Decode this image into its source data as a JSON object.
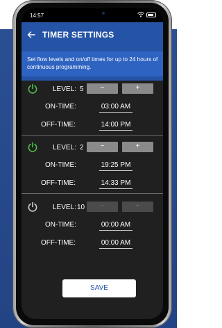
{
  "status": {
    "time": "14:57"
  },
  "header": {
    "title": "TIMER SETTINGS",
    "subtitle": "Set flow levels and on/off times for up to 24 hours of continuous programming."
  },
  "groups": [
    {
      "level_label": "LEVEL:",
      "level": "5",
      "on_label": "ON-TIME:",
      "on_time": "03:00 AM",
      "off_label": "OFF-TIME:",
      "off_time": "14:00 PM",
      "active": true
    },
    {
      "level_label": "LEVEL:",
      "level": "2",
      "on_label": "ON-TIME:",
      "on_time": "19:25 PM",
      "off_label": "OFF-TIME:",
      "off_time": "14:33 PM",
      "active": true
    },
    {
      "level_label": "LEVEL:",
      "level": "10",
      "on_label": "ON-TIME:",
      "on_time": "00:00 AM",
      "off_label": "OFF-TIME:",
      "off_time": "00:00 AM",
      "active": false
    }
  ],
  "buttons": {
    "minus": "−",
    "plus": "+",
    "save": "SAVE"
  },
  "colors": {
    "header": "#2553a6",
    "subtitle_band": "#2f63c2",
    "screen_bg": "#202020",
    "power_active": "#4cc04a",
    "power_inactive": "#cfcfcf"
  },
  "icons": {
    "back": "back-arrow-icon",
    "power": "power-icon",
    "wifi": "wifi-icon",
    "battery": "battery-icon"
  }
}
